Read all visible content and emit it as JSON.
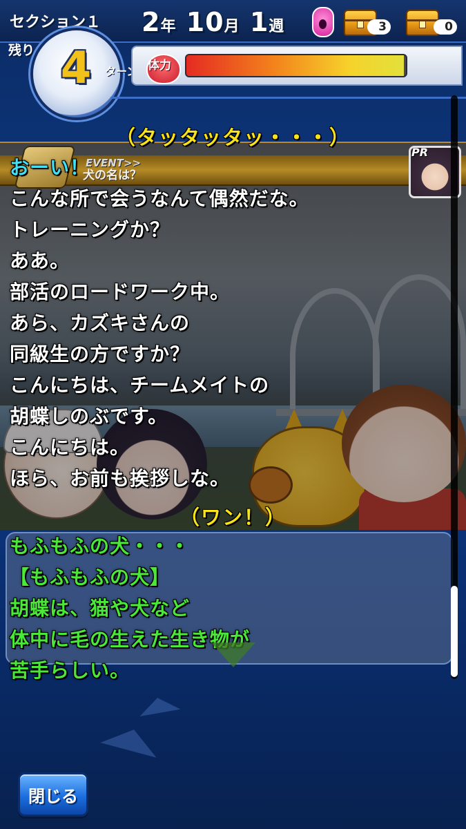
{
  "hud": {
    "section_label": "セクション１",
    "remaining_label": "残り",
    "turns_remaining": "4",
    "turn_unit": "ターン",
    "date": {
      "year": "2",
      "year_unit": "年",
      "month": "10",
      "month_unit": "月",
      "week": "1",
      "week_unit": "週"
    },
    "chest_counts": [
      "3",
      "0"
    ],
    "stamina_label": "体力",
    "stamina_fraction": 0.99,
    "colors": {
      "turn_number": "#f2c21a",
      "stamina_low": "#e42b22",
      "stamina_high": "#e3e03b"
    }
  },
  "event": {
    "tag": "EVENT>>",
    "title": "犬の名は？",
    "portrait_badge": "PR"
  },
  "dialogue": {
    "sfx_top": "（タッタッタッ・・・）",
    "upper_lines": [
      {
        "text": "おーい！",
        "color": "cyan"
      },
      {
        "text": "こんな所で会うなんて偶然だな。",
        "color": "white"
      },
      {
        "text": "トレーニングか？",
        "color": "white"
      },
      {
        "text": "ああ。",
        "color": "white"
      },
      {
        "text": "部活のロードワーク中。",
        "color": "white"
      },
      {
        "text": "あら、カズキさんの",
        "color": "white"
      },
      {
        "text": "同級生の方ですか？",
        "color": "white"
      },
      {
        "text": "こんにちは、チームメイトの",
        "color": "white"
      },
      {
        "text": "胡蝶しのぶです。",
        "color": "white"
      },
      {
        "text": "こんにちは。",
        "color": "white"
      },
      {
        "text": "ほら、お前も挨拶しな。",
        "color": "white"
      }
    ],
    "sfx_bottom": "（ワン！）",
    "lower_lines": [
      {
        "text": "もふもふの犬・・・",
        "color": "green"
      },
      {
        "text": "【もふもふの犬】",
        "color": "green"
      },
      {
        "text": "胡蝶は、猫や犬など",
        "color": "green"
      },
      {
        "text": "体中に毛の生えた生き物が",
        "color": "green"
      },
      {
        "text": "苦手らしい。",
        "color": "green"
      }
    ],
    "colors": {
      "white": "#ffffff",
      "cyan": "#43e0f2",
      "green": "#4be83a",
      "sfx": "#f8e21a"
    }
  },
  "footer": {
    "close_label": "閉じる"
  }
}
